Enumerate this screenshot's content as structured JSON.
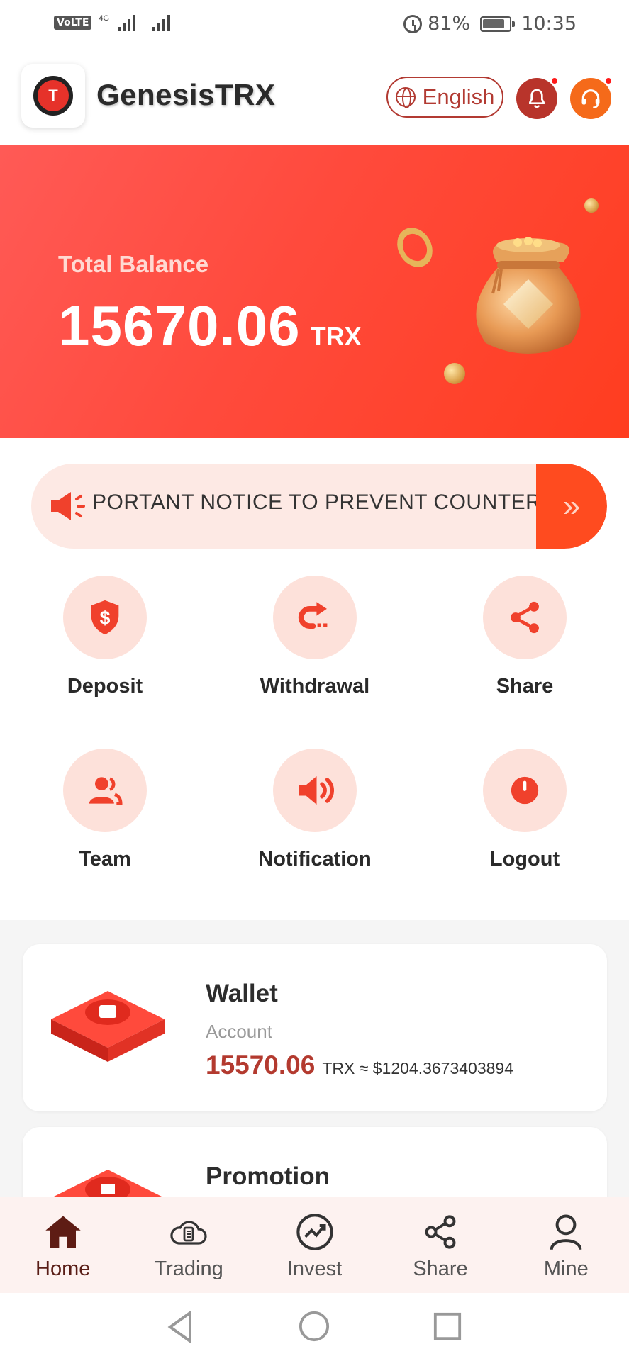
{
  "status_bar": {
    "volte": "VoLTE",
    "network": "4G",
    "battery": "81%",
    "time": "10:35"
  },
  "header": {
    "brand": "GenesisTRX",
    "logo_letter": "T",
    "language": "English"
  },
  "balance": {
    "label": "Total Balance",
    "value": "15670.06",
    "unit": "TRX"
  },
  "notice": {
    "text": "PORTANT NOTICE TO PREVENT COUNTERFEIT",
    "go_glyph": "»"
  },
  "actions": [
    {
      "label": "Deposit",
      "icon": "dollar-shield-icon"
    },
    {
      "label": "Withdrawal",
      "icon": "withdraw-arrow-icon"
    },
    {
      "label": "Share",
      "icon": "share-icon"
    },
    {
      "label": "Team",
      "icon": "team-icon"
    },
    {
      "label": "Notification",
      "icon": "megaphone-icon"
    },
    {
      "label": "Logout",
      "icon": "power-icon"
    }
  ],
  "wallet": {
    "title": "Wallet",
    "subtitle": "Account",
    "amount": "15570.06",
    "conversion": "TRX ≈ $1204.3673403894"
  },
  "promotion": {
    "title": "Promotion"
  },
  "bottom_nav": [
    {
      "label": "Home",
      "icon": "home-icon",
      "active": true
    },
    {
      "label": "Trading",
      "icon": "trading-cloud-icon",
      "active": false
    },
    {
      "label": "Invest",
      "icon": "invest-chart-icon",
      "active": false
    },
    {
      "label": "Share",
      "icon": "share-nodes-icon",
      "active": false
    },
    {
      "label": "Mine",
      "icon": "user-icon",
      "active": false
    }
  ],
  "colors": {
    "brand_red": "#ff4a3c",
    "accent_dark_red": "#b33a2f",
    "soft_pink": "#fde1da",
    "orange": "#f56a1a"
  }
}
